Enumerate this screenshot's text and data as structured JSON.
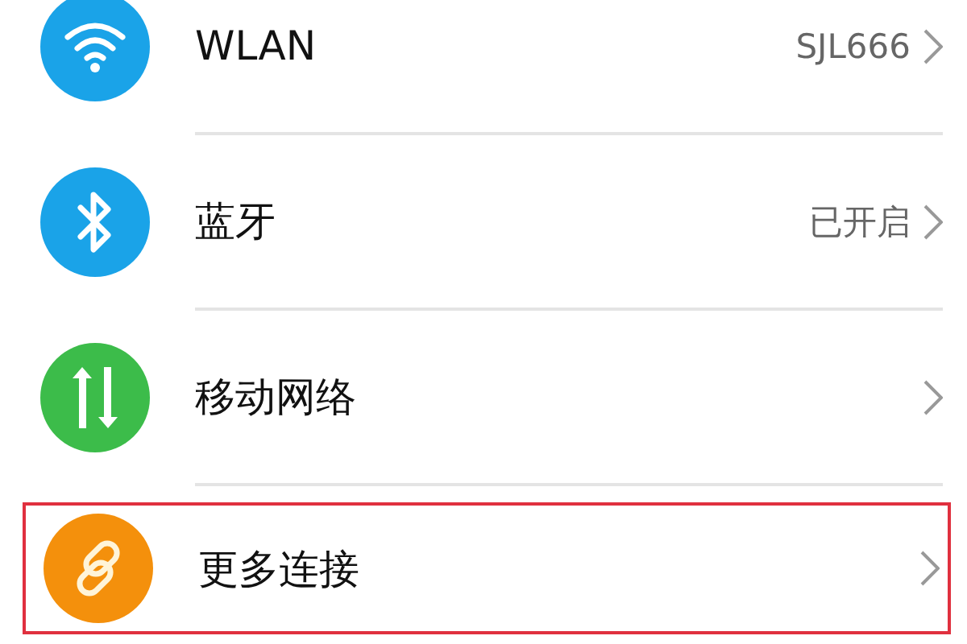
{
  "settings_list": [
    {
      "kind": "wifi",
      "color": "#1aa3e8",
      "label": "WLAN",
      "value": "SJL666",
      "highlighted": false
    },
    {
      "kind": "bluetooth",
      "color": "#1aa3e8",
      "label": "蓝牙",
      "value": "已开启",
      "highlighted": false
    },
    {
      "kind": "mobile",
      "color": "#3cbc4a",
      "label": "移动网络",
      "highlighted": false
    },
    {
      "kind": "link",
      "color": "#f4900c",
      "label": "更多连接",
      "highlighted": true
    }
  ]
}
